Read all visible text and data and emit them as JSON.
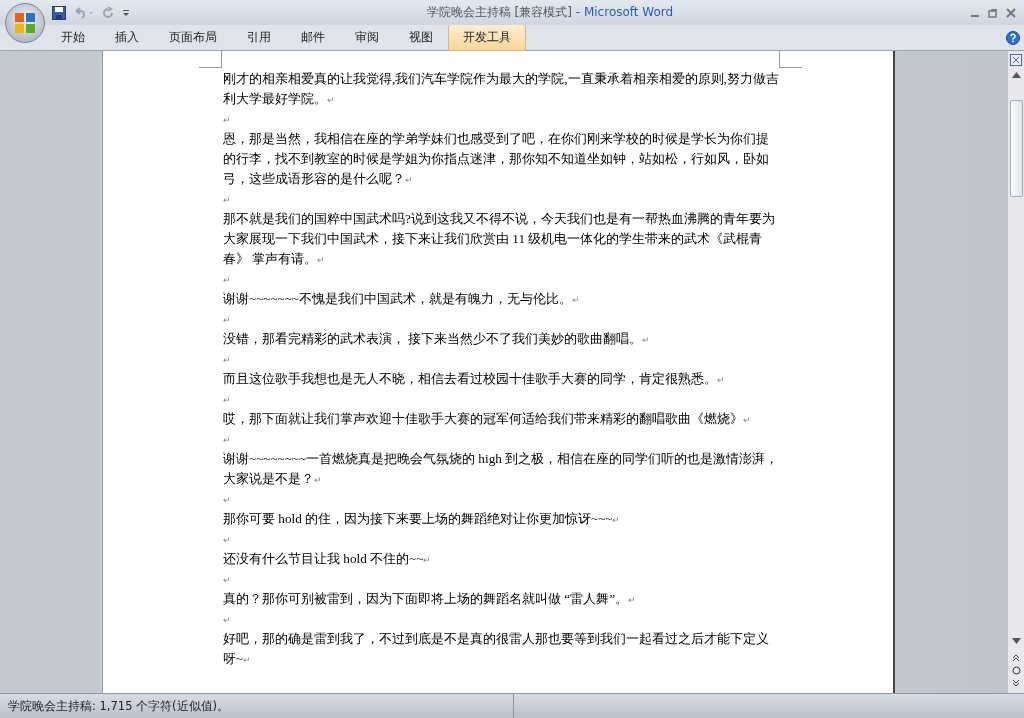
{
  "window": {
    "title": "学院晚会主持稿 [兼容模式]",
    "app": " - Microsoft Word"
  },
  "tabs": [
    {
      "label": "开始",
      "selected": false
    },
    {
      "label": "插入",
      "selected": false
    },
    {
      "label": "页面布局",
      "selected": false
    },
    {
      "label": "引用",
      "selected": false
    },
    {
      "label": "邮件",
      "selected": false
    },
    {
      "label": "审阅",
      "selected": false
    },
    {
      "label": "视图",
      "selected": false
    },
    {
      "label": "开发工具",
      "selected": true
    }
  ],
  "document": {
    "paragraphs": [
      {
        "kind": "text",
        "text": "刚才的相亲相爱真的让我觉得,我们汽车学院作为最大的学院,一直秉承着相亲相爱的原则,努力做吉利大学最好学院。",
        "mark": "↵"
      },
      {
        "kind": "empty",
        "mark": "↵"
      },
      {
        "kind": "text",
        "text": "恩，那是当然，我相信在座的学弟学妹们也感受到了吧，在你们刚来学校的时候是学长为你们提的行李，找不到教室的时候是学姐为你指点迷津，那你知不知道坐如钟，站如松，行如风，卧如弓，这些成语形容的是什么呢？",
        "mark": "↵"
      },
      {
        "kind": "empty",
        "mark": "↵"
      },
      {
        "kind": "text",
        "text": "那不就是我们的国粹中国武术吗?说到这我又不得不说，今天我们也是有一帮热血沸腾的青年要为大家展现一下我们中国武术，接下来让我们欣赏由 11 级机电一体化的学生带来的武术《武棍青春》 掌声有请。",
        "mark": "↵"
      },
      {
        "kind": "empty",
        "mark": "↵"
      },
      {
        "kind": "text",
        "text": "谢谢~~~~~~~不愧是我们中国武术，就是有魄力，无与伦比。",
        "mark": "↵"
      },
      {
        "kind": "empty",
        "mark": "↵"
      },
      {
        "kind": "text",
        "text": "没错，那看完精彩的武术表演， 接下来当然少不了我们美妙的歌曲翻唱。",
        "mark": "↵"
      },
      {
        "kind": "empty",
        "mark": "↵"
      },
      {
        "kind": "text",
        "text": "而且这位歌手我想也是无人不晓，相信去看过校园十佳歌手大赛的同学，肯定很熟悉。",
        "mark": "↵"
      },
      {
        "kind": "empty",
        "mark": "↵"
      },
      {
        "kind": "text",
        "text": "哎，那下面就让我们掌声欢迎十佳歌手大赛的冠军何适给我们带来精彩的翻唱歌曲《燃烧》",
        "mark": "↵"
      },
      {
        "kind": "empty",
        "mark": "↵"
      },
      {
        "kind": "text",
        "text": "谢谢~~~~~~~~一首燃烧真是把晚会气氛烧的 high 到之极，相信在座的同学们听的也是激情澎湃，大家说是不是？",
        "mark": "↵"
      },
      {
        "kind": "empty",
        "mark": "↵"
      },
      {
        "kind": "text",
        "text": "那你可要 hold 的住，因为接下来要上场的舞蹈绝对让你更加惊讶~~~",
        "mark": "↵"
      },
      {
        "kind": "empty",
        "mark": "↵"
      },
      {
        "kind": "text",
        "text": "还没有什么节目让我 hold 不住的~~",
        "mark": "↵"
      },
      {
        "kind": "empty",
        "mark": "↵"
      },
      {
        "kind": "text",
        "text": "真的？那你可别被雷到，因为下面即将上场的舞蹈名就叫做 “雷人舞”。",
        "mark": "↵"
      },
      {
        "kind": "empty",
        "mark": "↵"
      },
      {
        "kind": "text",
        "text": "好吧，那的确是雷到我了，不过到底是不是真的很雷人那也要等到我们一起看过之后才能下定义呀~",
        "mark": "↵"
      }
    ]
  },
  "status_bar": {
    "text": "学院晚会主持稿: 1,715 个字符(近似值)。"
  }
}
